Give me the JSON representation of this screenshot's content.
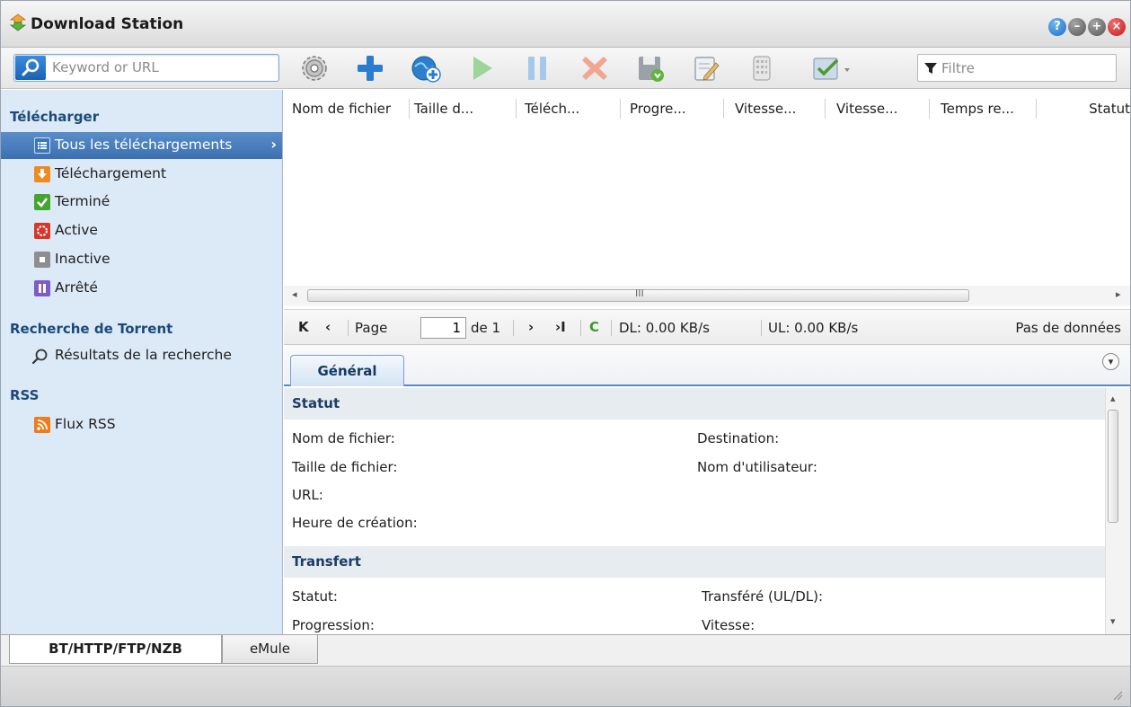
{
  "window": {
    "title": "Download Station",
    "buttons": [
      "help-icon",
      "minimize-icon",
      "maximize-icon",
      "close-icon"
    ]
  },
  "toolbar": {
    "search_placeholder": "Keyword or URL",
    "filter_placeholder": "Filtre",
    "icons": [
      "gear-icon",
      "add-icon",
      "add-url-icon",
      "play-icon",
      "pause-icon",
      "delete-icon",
      "save-icon",
      "edit-icon",
      "clear-icon",
      "select-icon"
    ]
  },
  "sidebar": {
    "sections": {
      "download": "Télécharger",
      "torrent": "Recherche de Torrent",
      "rss": "RSS"
    },
    "items": {
      "all": "Tous les téléchargements",
      "downloading": "Téléchargement",
      "finished": "Terminé",
      "active": "Active",
      "inactive": "Inactive",
      "stopped": "Arrêté",
      "search_results": "Résultats de la recherche",
      "rss_feeds": "Flux RSS"
    }
  },
  "grid": {
    "columns": [
      "Nom de fichier",
      "Taille d...",
      "Téléch...",
      "Progre...",
      "Vitesse...",
      "Vitesse...",
      "Temps re...",
      "Statut"
    ],
    "rows": []
  },
  "pager": {
    "page_label": "Page",
    "page_value": "1",
    "of_label": "de 1",
    "dl_speed": "DL: 0.00 KB/s",
    "ul_speed": "UL: 0.00 KB/s",
    "no_data": "Pas de données"
  },
  "detail": {
    "tab": "Général",
    "status_group": "Statut",
    "fields": {
      "filename": "Nom de fichier:",
      "destination": "Destination:",
      "filesize": "Taille de fichier:",
      "username": "Nom d'utilisateur:",
      "url": "URL:",
      "created": "Heure de création:"
    },
    "transfer_group": "Transfert",
    "transfer_fields": {
      "status": "Statut:",
      "transferred": "Transféré (UL/DL):",
      "progress": "Progression:",
      "speed": "Vitesse:"
    }
  },
  "bottom_tabs": {
    "bt": "BT/HTTP/FTP/NZB",
    "emule": "eMule"
  },
  "colors": {
    "sidebar_bg": "#dce9f6",
    "selection": "#3c70b0",
    "accent": "#1b4a7a"
  }
}
